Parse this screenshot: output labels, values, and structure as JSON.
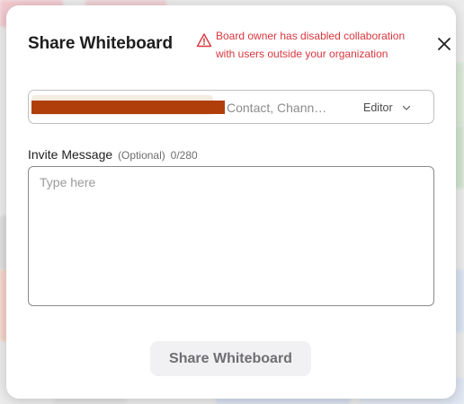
{
  "dialog": {
    "title": "Share Whiteboard",
    "warning_line1": "Board owner has disabled collaboration",
    "warning_line2": "with users outside your organization",
    "close_icon": "close-icon",
    "warning_icon": "warning-triangle-icon"
  },
  "recipients": {
    "placeholder": "Contact, Chann…",
    "value": "",
    "role": "Editor",
    "role_icon": "chevron-down-icon"
  },
  "message": {
    "label": "Invite Message",
    "optional": "(Optional)",
    "count": "0/280",
    "placeholder": "Type here",
    "value": ""
  },
  "actions": {
    "submit_label": "Share Whiteboard"
  },
  "colors": {
    "warning": "#d9363e",
    "redaction": "#b03e0b",
    "button_bg": "#f1f1f3"
  }
}
